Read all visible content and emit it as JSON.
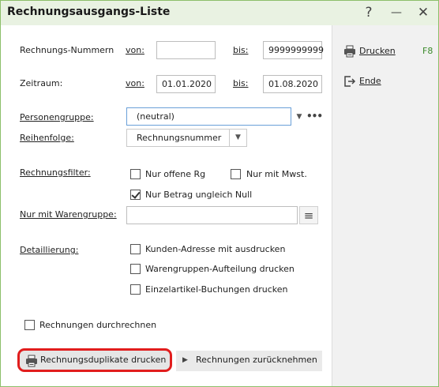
{
  "window": {
    "title": "Rechnungsausgangs-Liste"
  },
  "titlebar_icons": [
    "help-icon",
    "minimize-icon",
    "close-icon"
  ],
  "titlebar_glyphs": {
    "help": "?",
    "minimize": "—",
    "close": "✕"
  },
  "form": {
    "rechnungsnummern": {
      "label": "Rechnungs-Nummern",
      "von_label": "von:",
      "von_value": "",
      "bis_label": "bis:",
      "bis_value": "9999999999"
    },
    "zeitraum": {
      "label": "Zeitraum:",
      "von_label": "von:",
      "von_value": "01.01.2020",
      "bis_label": "bis:",
      "bis_value": "01.08.2020"
    },
    "personengruppe": {
      "label": "Personengruppe:",
      "value": "(neutral)"
    },
    "reihenfolge": {
      "label": "Reihenfolge:",
      "value": "Rechnungsnummer"
    },
    "rechnungsfilter": {
      "label": "Rechnungsfilter:",
      "options": [
        {
          "label": "Nur offene Rg",
          "checked": false
        },
        {
          "label": "Nur mit Mwst.",
          "checked": false
        },
        {
          "label": "Nur Betrag ungleich Null",
          "checked": true
        }
      ]
    },
    "warengruppe": {
      "label": "Nur mit Warengruppe:",
      "value": ""
    },
    "detaillierung": {
      "label": "Detaillierung:",
      "options": [
        {
          "label": "Kunden-Adresse mit ausdrucken",
          "checked": false
        },
        {
          "label": "Warengruppen-Aufteilung drucken",
          "checked": false
        },
        {
          "label": "Einzelartikel-Buchungen drucken",
          "checked": false
        }
      ]
    },
    "durchrechnen": {
      "label": "Rechnungen durchrechnen",
      "checked": false
    }
  },
  "bottom_buttons": {
    "duplikate": "Rechnungsduplikate drucken",
    "zuruecknehmen": "Rechnungen zurücknehmen"
  },
  "side": {
    "drucken": {
      "label": "Drucken",
      "shortcut": "F8"
    },
    "ende": {
      "label": "Ende"
    }
  },
  "colors": {
    "accent_green": "#3a8a2a",
    "titlebar_bg": "#e9f2e2",
    "highlight_red": "#e11d1d",
    "border_green": "#8cbf6a"
  }
}
